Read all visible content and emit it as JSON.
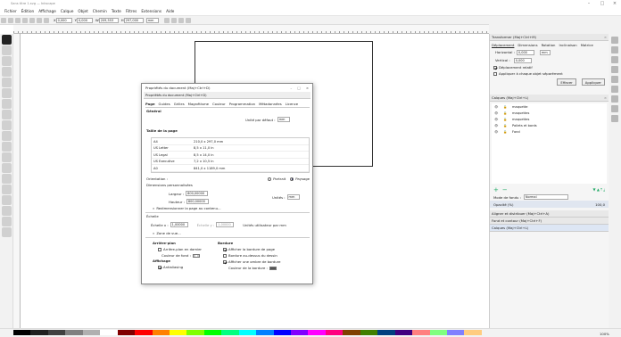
{
  "window": {
    "title": "Sans titre 1.svg — Inkscape"
  },
  "menu": [
    "Fichier",
    "Édition",
    "Affichage",
    "Calque",
    "Objet",
    "Chemin",
    "Texte",
    "Filtres",
    "Extensions",
    "Aide"
  ],
  "toolbar": {
    "x": "0,000",
    "y": "0,000",
    "w": "209,553",
    "h": "297,000",
    "unit": "mm"
  },
  "doc_props": {
    "title": "Propriétés du document (Maj+Ctrl+D)",
    "panel_title": "Propriétés du document (Maj+Ctrl+D)",
    "tabs": [
      "Page",
      "Guides",
      "Grilles",
      "Magnétisme",
      "Couleur",
      "Programmation",
      "Métadonnées",
      "Licence"
    ],
    "general": "Général",
    "default_unit_label": "Unité par défaut :",
    "default_unit_value": "mm",
    "page_size": "Taille de la page",
    "sizes": [
      {
        "name": "A4",
        "dims": "210,0 x 297,0 mm"
      },
      {
        "name": "US Letter",
        "dims": "8,5 x 11,0 in"
      },
      {
        "name": "US Legal",
        "dims": "8,5 x 14,0 in"
      },
      {
        "name": "US Executive",
        "dims": "7,2 x 10,5 in"
      },
      {
        "name": "A0",
        "dims": "841,0 x 1189,0 mm"
      }
    ],
    "orientation_label": "Orientation :",
    "portrait": "Portrait",
    "landscape": "Paysage",
    "custom_size": "Dimensions personnalisées",
    "width_label": "Largeur :",
    "width_value": "800,00000",
    "height_label": "Hauteur :",
    "height_value": "800,00000",
    "unit_label": "Unités :",
    "unit_value": "mm",
    "resize_label": "Redimensionner la page au contenu...",
    "scale_label": "Échelle",
    "scale_x_label": "Échelle x :",
    "scale_x_value": "1,00000",
    "scale_y_label": "Échelle y :",
    "scale_y_value": "1,00000",
    "scale_units": "Unités utilisateur par mm",
    "viewbox_label": "Zone de vue...",
    "background_heading": "Arrière-plan",
    "bg_checker": "Arrière-plan en damier",
    "bg_color": "Couleur de fond :",
    "display_heading": "Affichage",
    "antialias": "Antialiasing",
    "border_heading": "Bordure",
    "show_border": "Afficher la bordure de page",
    "border_top": "Bordure au-dessus du dessin",
    "border_shadow": "Afficher une ombre de bordure",
    "border_color": "Couleur de la bordure :"
  },
  "transform": {
    "title": "Transformer (Maj+Ctrl+M)",
    "tabs": [
      "Déplacement",
      "Dimensions",
      "Rotation",
      "Inclinaison",
      "Matrice"
    ],
    "horizontal_label": "Horizontal :",
    "horizontal_value": "0,000",
    "vertical_label": "Vertical :",
    "vertical_value": "0,000",
    "unit": "mm",
    "relative": "Déplacement relatif",
    "apply_each": "Appliquer à chaque objet séparément",
    "clear": "Effacer",
    "apply": "Appliquer"
  },
  "layers": {
    "title": "Calques (Maj+Ctrl+L)",
    "items": [
      "maquette",
      "maquettes",
      "maquettes",
      "Pailets et bords",
      "Fond"
    ],
    "blend_label": "Mode de fondu :",
    "blend_value": "Normal",
    "opacity_label": "Opacité (%)",
    "opacity_value": "100,0"
  },
  "lower_panels": [
    "Aligner et distribuer (Maj+Ctrl+A)",
    "Fond et contour (Maj+Ctrl+F)",
    "Calques (Maj+Ctrl+L)"
  ],
  "palette": [
    "#000000",
    "#202020",
    "#404040",
    "#808080",
    "#b0b0b0",
    "#ffffff",
    "#800000",
    "#ff0000",
    "#ff8000",
    "#ffff00",
    "#80ff00",
    "#00ff00",
    "#00ff80",
    "#00ffff",
    "#0080ff",
    "#0000ff",
    "#8000ff",
    "#ff00ff",
    "#ff0080",
    "#804000",
    "#408000",
    "#004080",
    "#400080",
    "#ff8080",
    "#80ff80",
    "#8080ff",
    "#ffcc80"
  ],
  "status": {
    "zoom": "100%"
  }
}
